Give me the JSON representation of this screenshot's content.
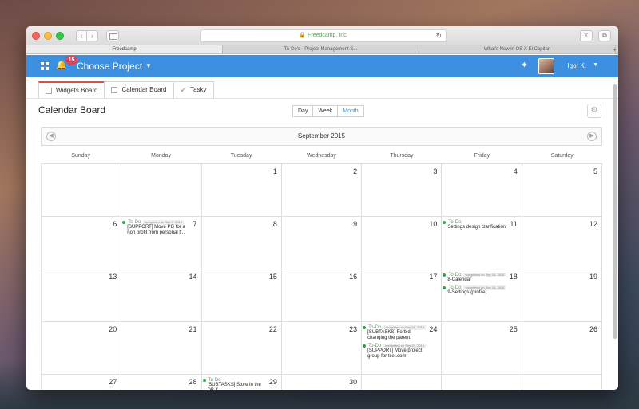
{
  "browser": {
    "url": "Freedcamp, Inc.",
    "tabs": [
      {
        "label": "Freedcamp",
        "active": true
      },
      {
        "label": "To-Do's - Project Management S...",
        "active": false
      },
      {
        "label": "What's New in OS X El Capitan",
        "active": false
      }
    ],
    "icons": {
      "back": "‹",
      "forward": "›",
      "reload": "↻",
      "share": "⇪",
      "tabs": "⧉",
      "plus": "+"
    }
  },
  "app": {
    "notification_count": "15",
    "project_label": "Choose Project",
    "user_name": "Igor K.",
    "accent": "#3d8fdf"
  },
  "board_tabs": [
    {
      "label": "Widgets Board",
      "active": true
    },
    {
      "label": "Calendar Board",
      "active": false
    },
    {
      "label": "Tasky",
      "active": false
    }
  ],
  "calendar": {
    "title": "Calendar Board",
    "views": [
      {
        "label": "Day",
        "active": false
      },
      {
        "label": "Week",
        "active": false
      },
      {
        "label": "Month",
        "active": true
      }
    ],
    "month_label": "September 2015",
    "weekdays": [
      "Sunday",
      "Monday",
      "Tuesday",
      "Wednesday",
      "Thursday",
      "Friday",
      "Saturday"
    ],
    "cells": [
      {
        "day": "",
        "events": []
      },
      {
        "day": "",
        "events": []
      },
      {
        "day": "1",
        "events": []
      },
      {
        "day": "2",
        "events": []
      },
      {
        "day": "3",
        "events": []
      },
      {
        "day": "4",
        "events": []
      },
      {
        "day": "5",
        "events": []
      },
      {
        "day": "6",
        "events": []
      },
      {
        "day": "7",
        "events": [
          {
            "status": "To-Do",
            "completed": "completed on Sep 7, 2015",
            "title": "[SUPPORT] Move PG for a non profit from personal t..."
          }
        ]
      },
      {
        "day": "8",
        "events": []
      },
      {
        "day": "9",
        "events": []
      },
      {
        "day": "10",
        "events": []
      },
      {
        "day": "11",
        "events": [
          {
            "status": "To-Do",
            "completed": "",
            "title": "Settings design clarification"
          }
        ]
      },
      {
        "day": "12",
        "events": []
      },
      {
        "day": "13",
        "events": []
      },
      {
        "day": "14",
        "events": []
      },
      {
        "day": "15",
        "events": []
      },
      {
        "day": "16",
        "events": []
      },
      {
        "day": "17",
        "events": []
      },
      {
        "day": "18",
        "events": [
          {
            "status": "To-Do",
            "completed": "completed on Sep 16, 2015",
            "title": "8-Calendar"
          },
          {
            "status": "To-Do",
            "completed": "completed on Sep 18, 2015",
            "title": "9-Settings (profile)"
          }
        ]
      },
      {
        "day": "19",
        "events": []
      },
      {
        "day": "20",
        "events": []
      },
      {
        "day": "21",
        "events": []
      },
      {
        "day": "22",
        "events": []
      },
      {
        "day": "23",
        "events": []
      },
      {
        "day": "24",
        "events": [
          {
            "status": "To-Do",
            "completed": "completed on Sep 25, 2015",
            "title": "[SUBTASKS] Forbid changing the parent"
          },
          {
            "status": "To-Do",
            "completed": "completed on Sep 24, 2015",
            "title": "[SUPPORT] Move project group for tcet.com"
          }
        ]
      },
      {
        "day": "25",
        "events": []
      },
      {
        "day": "26",
        "events": []
      },
      {
        "day": "27",
        "events": []
      },
      {
        "day": "28",
        "events": []
      },
      {
        "day": "29",
        "events": [
          {
            "status": "To-Do",
            "completed": "",
            "title": "[SUBTASKS] Store in the DB if"
          }
        ]
      },
      {
        "day": "30",
        "events": []
      },
      {
        "day": "",
        "events": []
      },
      {
        "day": "",
        "events": []
      },
      {
        "day": "",
        "events": []
      }
    ]
  }
}
